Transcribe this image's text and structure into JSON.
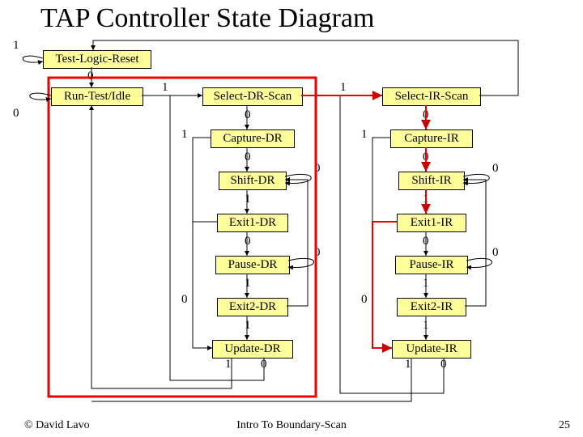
{
  "title": "TAP Controller State Diagram",
  "states": {
    "tlr": "Test-Logic-Reset",
    "rti": "Run-Test/Idle",
    "sel_dr": "Select-DR-Scan",
    "cap_dr": "Capture-DR",
    "shift_dr": "Shift-DR",
    "exit1_dr": "Exit1-DR",
    "pause_dr": "Pause-DR",
    "exit2_dr": "Exit2-DR",
    "update_dr": "Update-DR",
    "sel_ir": "Select-IR-Scan",
    "cap_ir": "Capture-IR",
    "shift_ir": "Shift-IR",
    "exit1_ir": "Exit1-IR",
    "pause_ir": "Pause-IR",
    "exit2_ir": "Exit2-IR",
    "update_ir": "Update-IR"
  },
  "labels": {
    "l_tlr_self": "1",
    "l_tlr_rti": "0",
    "l_rti_self": "0",
    "l_rti_seldr": "1",
    "l_seldr_selir": "1",
    "l_seldr_capdr": "0",
    "l_capdr_left": "1",
    "l_capdr_shift": "0",
    "l_shiftdr_self": "0",
    "l_shiftdr_exit1": "1",
    "l_exit1dr_pause": "0",
    "l_pausedr_self": "0",
    "l_pausedr_exit2": "1",
    "l_exit2dr_left": "0",
    "l_exit2dr_update": "1",
    "l_updatedr_l": "1",
    "l_updatedr_r": "0",
    "l_selir_capir": "0",
    "l_capir_left": "1",
    "l_capir_shift": "0",
    "l_shiftir_self": "0",
    "l_shiftir_exit1": "1",
    "l_exit1ir_pause": "0",
    "l_pauseir_self": "0",
    "l_pauseir_exit2": "1",
    "l_exit2ir_left": "0",
    "l_exit2ir_update": "1",
    "l_updateir_l": "1",
    "l_updateir_r": "0"
  },
  "footer": {
    "left": "© David Lavo",
    "center": "Intro To Boundary-Scan",
    "right": "25"
  }
}
